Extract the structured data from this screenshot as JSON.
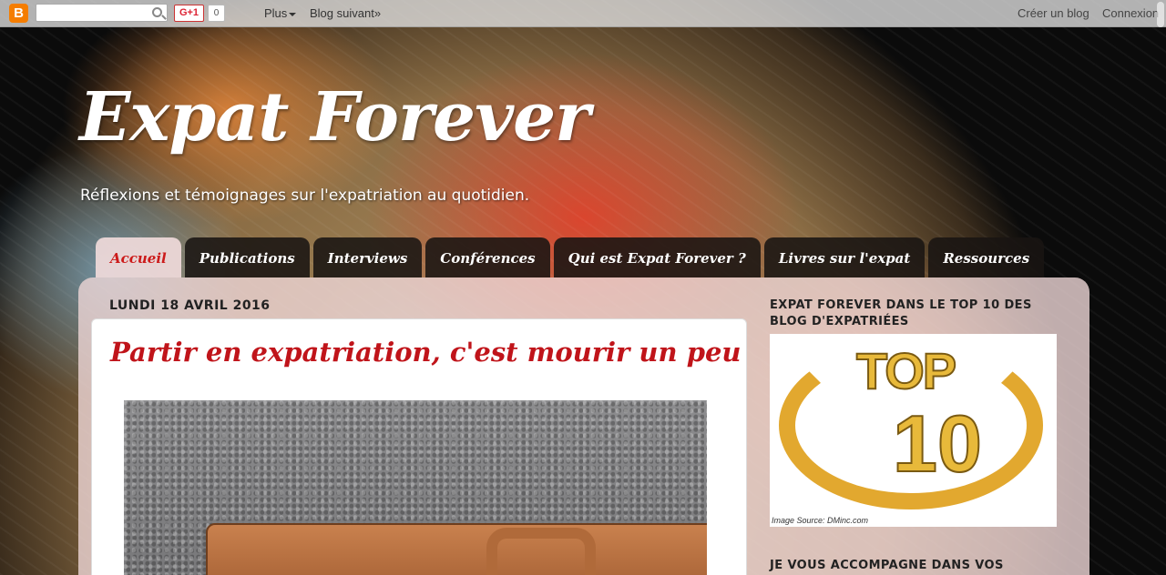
{
  "navbar": {
    "logo_letter": "B",
    "search_placeholder": "",
    "gplus_label": "G+1",
    "gplus_count": "0",
    "more_label": "Plus",
    "next_blog_label": "Blog suivant»",
    "create_blog_label": "Créer un blog",
    "login_label": "Connexion"
  },
  "header": {
    "title": "Expat Forever",
    "description": "Réflexions et témoignages sur l'expatriation au quotidien."
  },
  "tabs": [
    {
      "label": "Accueil",
      "active": true
    },
    {
      "label": "Publications",
      "active": false
    },
    {
      "label": "Interviews",
      "active": false
    },
    {
      "label": "Conférences",
      "active": false
    },
    {
      "label": "Qui est Expat Forever ?",
      "active": false
    },
    {
      "label": "Livres sur l'expat",
      "active": false
    },
    {
      "label": "Ressources",
      "active": false
    }
  ],
  "main": {
    "date_header": "LUNDI 18 AVRIL 2016",
    "post_title": "Partir en expatriation, c'est mourir un peu"
  },
  "sidebar": {
    "widget1_title": "EXPAT FOREVER DANS LE TOP 10 DES BLOG D'EXPATRIÉES",
    "widget1_image_top": "TOP",
    "widget1_image_ten": "10",
    "widget1_image_source": "Image Source: DMinc.com",
    "widget2_title": "JE VOUS ACCOMPAGNE DANS VOS"
  },
  "colors": {
    "accent_red": "#c0141a",
    "tab_dark": "#19140f",
    "panel_pink": "#eed6d6",
    "logo_orange": "#f57d00"
  }
}
